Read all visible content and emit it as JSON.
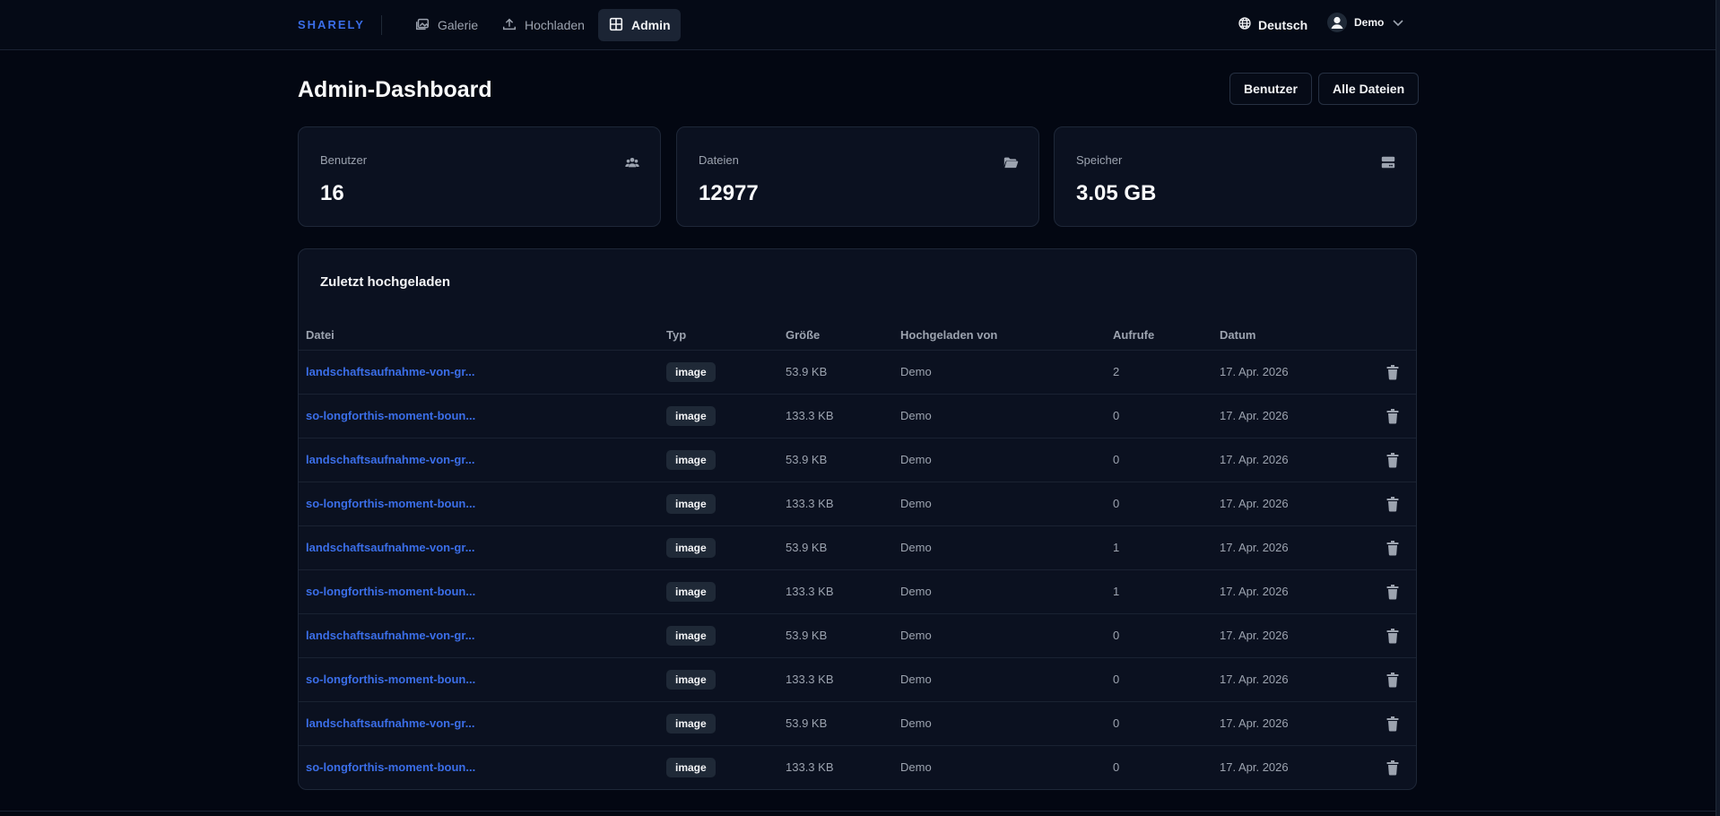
{
  "app": {
    "brand": "SHARELY"
  },
  "nav": {
    "items": [
      {
        "label": "Galerie",
        "icon": "gallery-icon",
        "active": false
      },
      {
        "label": "Hochladen",
        "icon": "upload-icon",
        "active": false
      },
      {
        "label": "Admin",
        "icon": "dashboard-icon",
        "active": true
      }
    ],
    "language": "Deutsch",
    "user": "Demo"
  },
  "page": {
    "title": "Admin-Dashboard",
    "buttons": {
      "users": "Benutzer",
      "all_files": "Alle Dateien"
    }
  },
  "stats": [
    {
      "label": "Benutzer",
      "value": "16",
      "icon": "users-icon"
    },
    {
      "label": "Dateien",
      "value": "12977",
      "icon": "folder-open-icon"
    },
    {
      "label": "Speicher",
      "value": "3.05 GB",
      "icon": "storage-icon"
    }
  ],
  "recent": {
    "title": "Zuletzt hochgeladen",
    "columns": {
      "file": "Datei",
      "type": "Typ",
      "size": "Größe",
      "uploaded_by": "Hochgeladen von",
      "views": "Aufrufe",
      "date": "Datum"
    },
    "rows": [
      {
        "file": "landschaftsaufnahme-von-gr...",
        "type": "image",
        "size": "53.9 KB",
        "by": "Demo",
        "views": "2",
        "date": "17. Apr. 2026"
      },
      {
        "file": "so-longforthis-moment-boun...",
        "type": "image",
        "size": "133.3 KB",
        "by": "Demo",
        "views": "0",
        "date": "17. Apr. 2026"
      },
      {
        "file": "landschaftsaufnahme-von-gr...",
        "type": "image",
        "size": "53.9 KB",
        "by": "Demo",
        "views": "0",
        "date": "17. Apr. 2026"
      },
      {
        "file": "so-longforthis-moment-boun...",
        "type": "image",
        "size": "133.3 KB",
        "by": "Demo",
        "views": "0",
        "date": "17. Apr. 2026"
      },
      {
        "file": "landschaftsaufnahme-von-gr...",
        "type": "image",
        "size": "53.9 KB",
        "by": "Demo",
        "views": "1",
        "date": "17. Apr. 2026"
      },
      {
        "file": "so-longforthis-moment-boun...",
        "type": "image",
        "size": "133.3 KB",
        "by": "Demo",
        "views": "1",
        "date": "17. Apr. 2026"
      },
      {
        "file": "landschaftsaufnahme-von-gr...",
        "type": "image",
        "size": "53.9 KB",
        "by": "Demo",
        "views": "0",
        "date": "17. Apr. 2026"
      },
      {
        "file": "so-longforthis-moment-boun...",
        "type": "image",
        "size": "133.3 KB",
        "by": "Demo",
        "views": "0",
        "date": "17. Apr. 2026"
      },
      {
        "file": "landschaftsaufnahme-von-gr...",
        "type": "image",
        "size": "53.9 KB",
        "by": "Demo",
        "views": "0",
        "date": "17. Apr. 2026"
      },
      {
        "file": "so-longforthis-moment-boun...",
        "type": "image",
        "size": "133.3 KB",
        "by": "Demo",
        "views": "0",
        "date": "17. Apr. 2026"
      }
    ]
  },
  "colors": {
    "background": "#030712",
    "card": "#0b1120",
    "accent": "#3b6ee8",
    "muted": "#9ca3af"
  }
}
